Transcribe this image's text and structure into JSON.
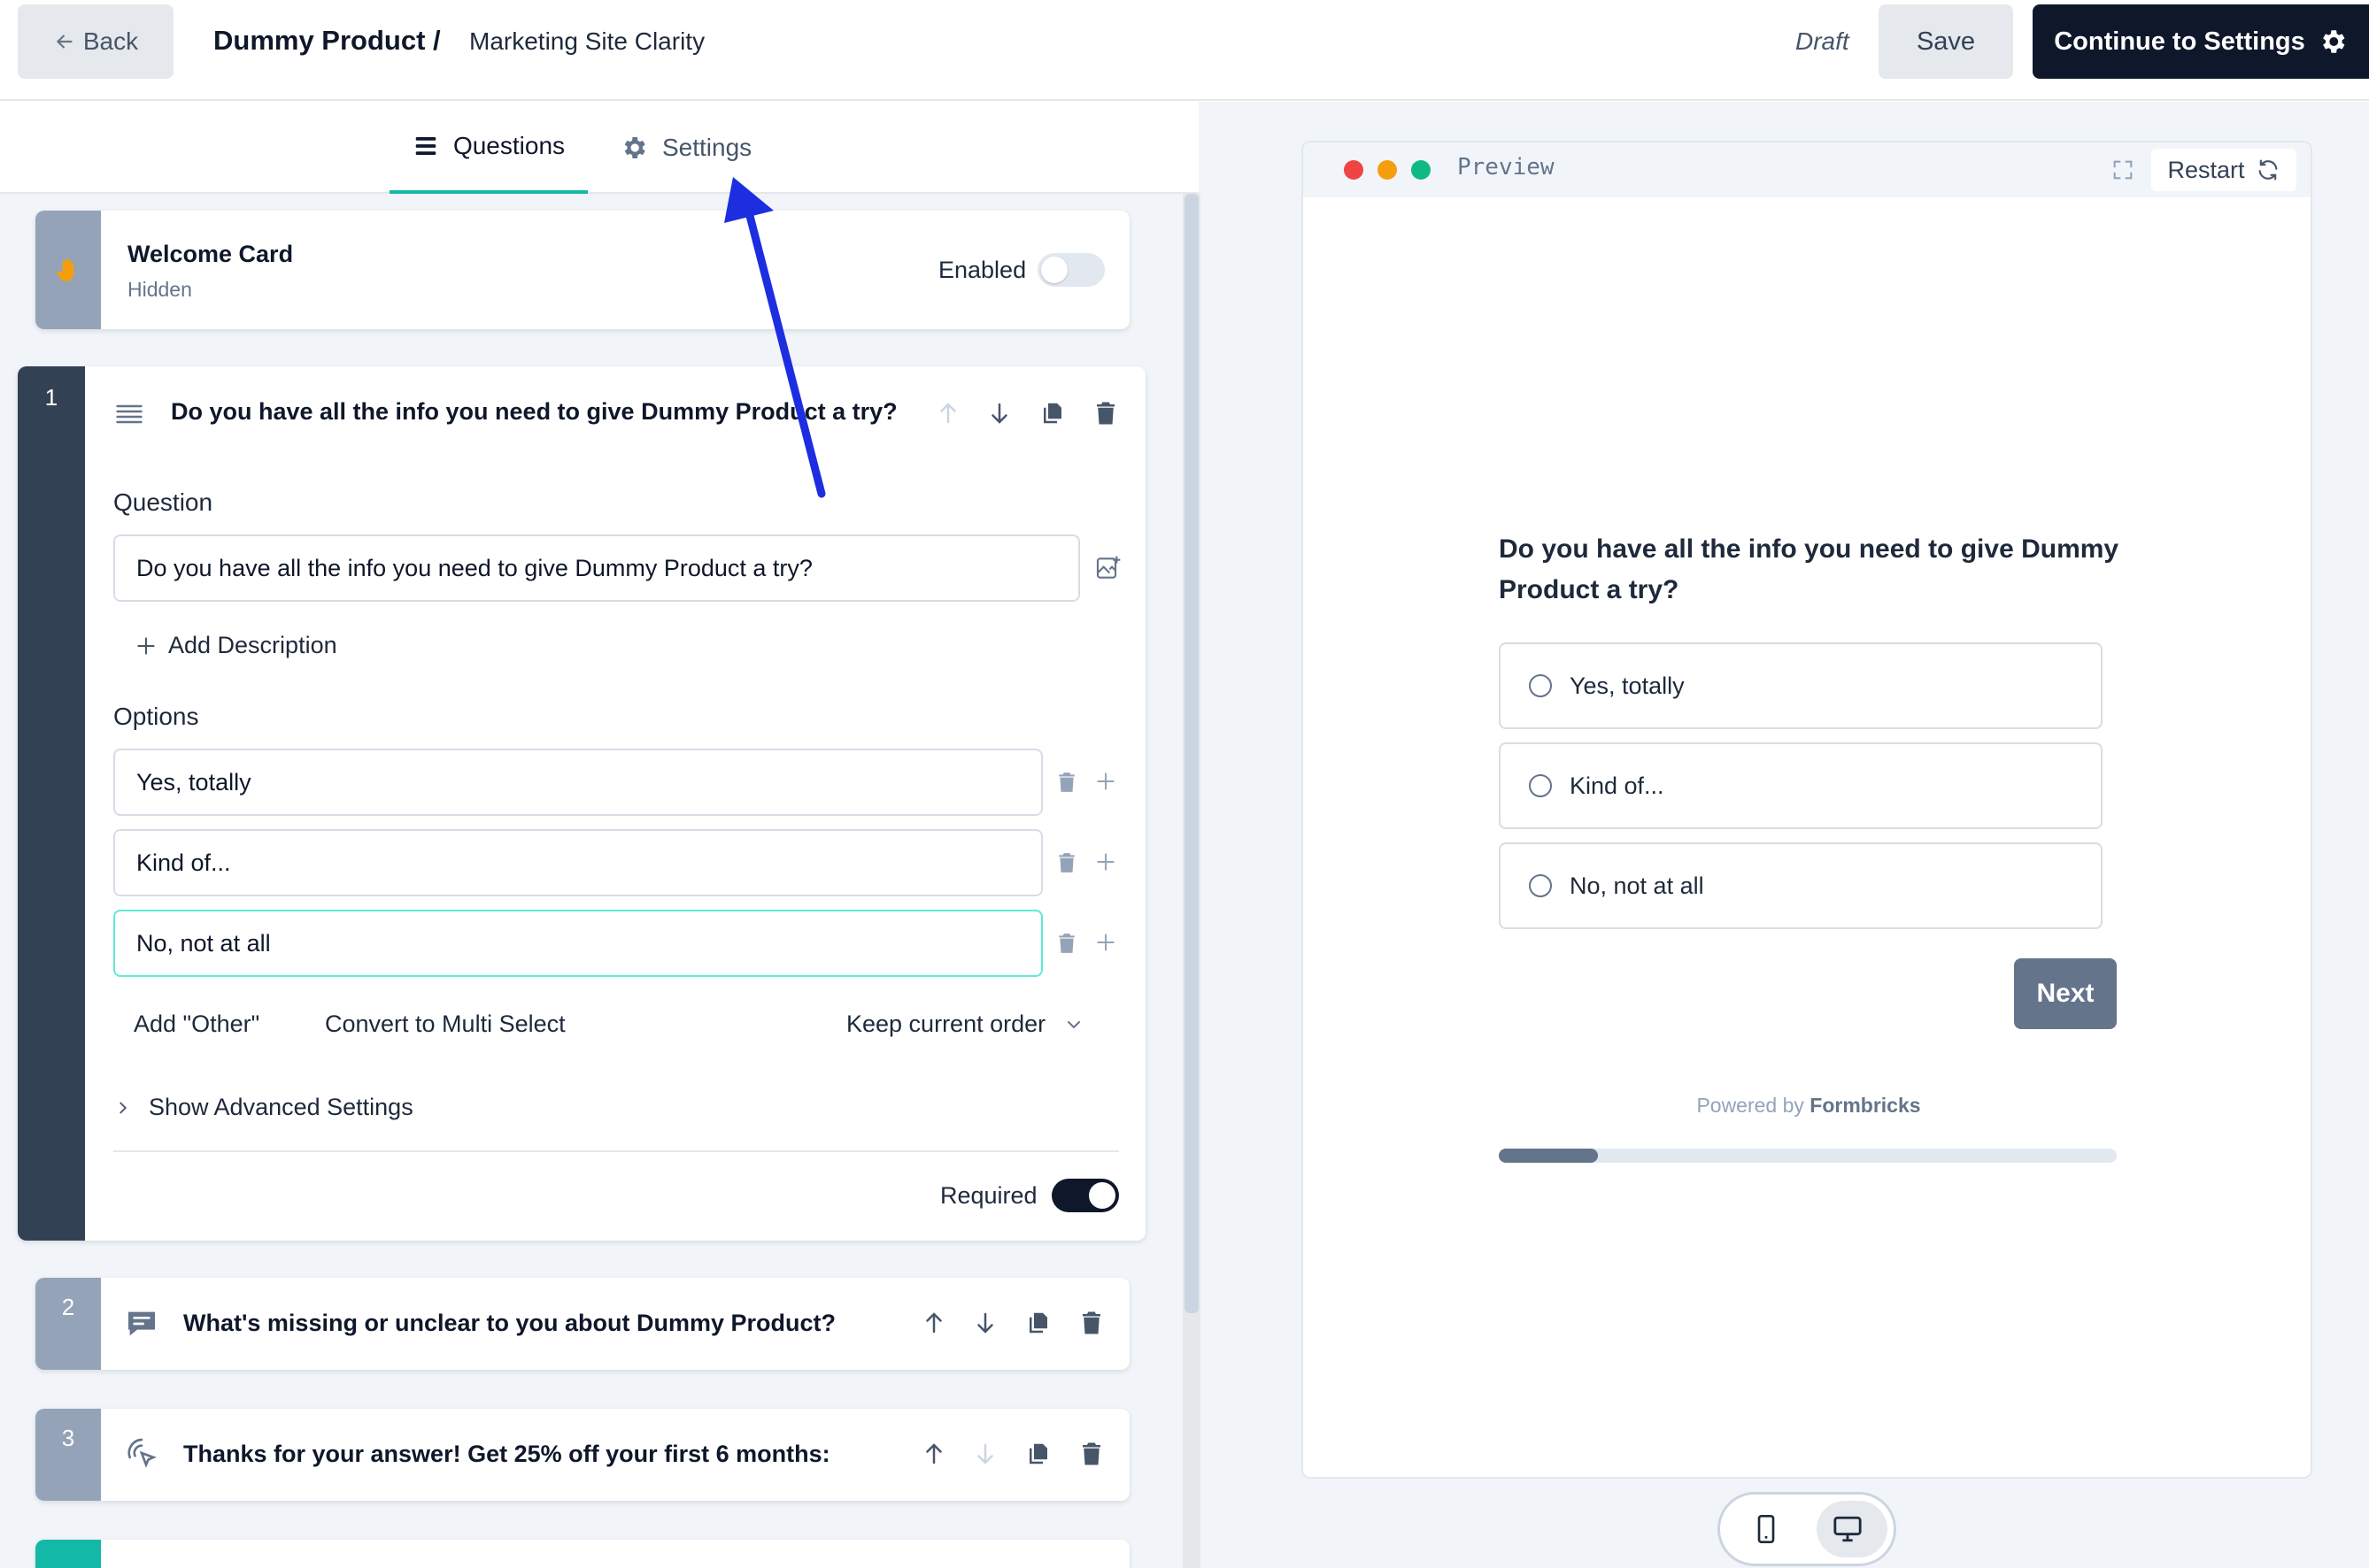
{
  "header": {
    "back_label": "Back",
    "product": "Dummy Product /",
    "survey_name": "Marketing Site Clarity",
    "status": "Draft",
    "save_label": "Save",
    "continue_label": "Continue to Settings"
  },
  "tabs": {
    "questions": "Questions",
    "settings": "Settings"
  },
  "welcome_card": {
    "title": "Welcome Card",
    "subtitle": "Hidden",
    "enabled_label": "Enabled",
    "enabled": false
  },
  "question1": {
    "number": "1",
    "title": "Do you have all the info you need to give Dummy Product a try?",
    "question_label": "Question",
    "question_value": "Do you have all the info you need to give Dummy Product a try?",
    "add_description": "Add Description",
    "options_label": "Options",
    "options": [
      "Yes, totally",
      "Kind of...",
      "No, not at all"
    ],
    "add_other": "Add \"Other\"",
    "convert": "Convert to Multi Select",
    "order": "Keep current order",
    "advanced": "Show Advanced Settings",
    "required_label": "Required",
    "required": true
  },
  "question2": {
    "number": "2",
    "title": "What's missing or unclear to you about Dummy Product?"
  },
  "question3": {
    "number": "3",
    "title": "Thanks for your answer! Get 25% off your first 6 months:"
  },
  "preview": {
    "title": "Preview",
    "restart_label": "Restart",
    "question": "Do you have all the info you need to give Dummy Product a try?",
    "options": [
      "Yes, totally",
      "Kind of...",
      "No, not at all"
    ],
    "next_label": "Next",
    "powered_by": "Powered by",
    "brand": "Formbricks",
    "progress": 0.16
  },
  "colors": {
    "accent": "#14b8a6",
    "dark": "#0f172a",
    "slate": "#64748b",
    "annotation_arrow": "#1d2ee0"
  }
}
